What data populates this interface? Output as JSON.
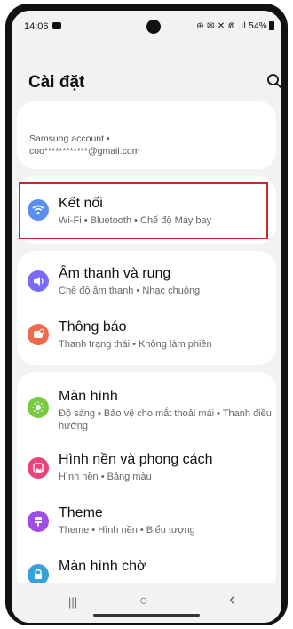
{
  "status": {
    "time": "14:06",
    "right": "⊛ ✉ ✕ ⋒ .ıl 54%"
  },
  "header": {
    "title": "Cài đặt"
  },
  "account": {
    "line1": "Samsung account  •",
    "line2": "coo************@gmail.com"
  },
  "items": [
    {
      "title": "Kết nối",
      "subtitle": "Wi-Fi  •  Bluetooth  •  Chế độ Máy bay",
      "icon": "wifi-icon",
      "color": "#5b8def"
    },
    {
      "title": "Âm thanh và rung",
      "subtitle": "Chế độ âm thanh  •  Nhạc chuông",
      "icon": "speaker-icon",
      "color": "#7b6cf6"
    },
    {
      "title": "Thông báo",
      "subtitle": "Thanh trạng thái  •  Không làm phiền",
      "icon": "notification-icon",
      "color": "#f0694b"
    },
    {
      "title": "Màn hình",
      "subtitle": "Độ sáng  •  Bảo vệ cho mắt thoải mái  •  Thanh điều hướng",
      "icon": "brightness-icon",
      "color": "#7ac943"
    },
    {
      "title": "Hình nền và phong cách",
      "subtitle": "Hình nền  •  Bảng màu",
      "icon": "wallpaper-icon",
      "color": "#e8447a"
    },
    {
      "title": "Theme",
      "subtitle": "Theme  •  Hình nền  •  Biểu tượng",
      "icon": "theme-icon",
      "color": "#a04de3"
    },
    {
      "title": "Màn hình chờ",
      "subtitle": "",
      "icon": "lockscreen-icon",
      "color": "#3aa0d8"
    }
  ],
  "navbar": {
    "recents": "|||",
    "home": "○",
    "back": "‹"
  }
}
